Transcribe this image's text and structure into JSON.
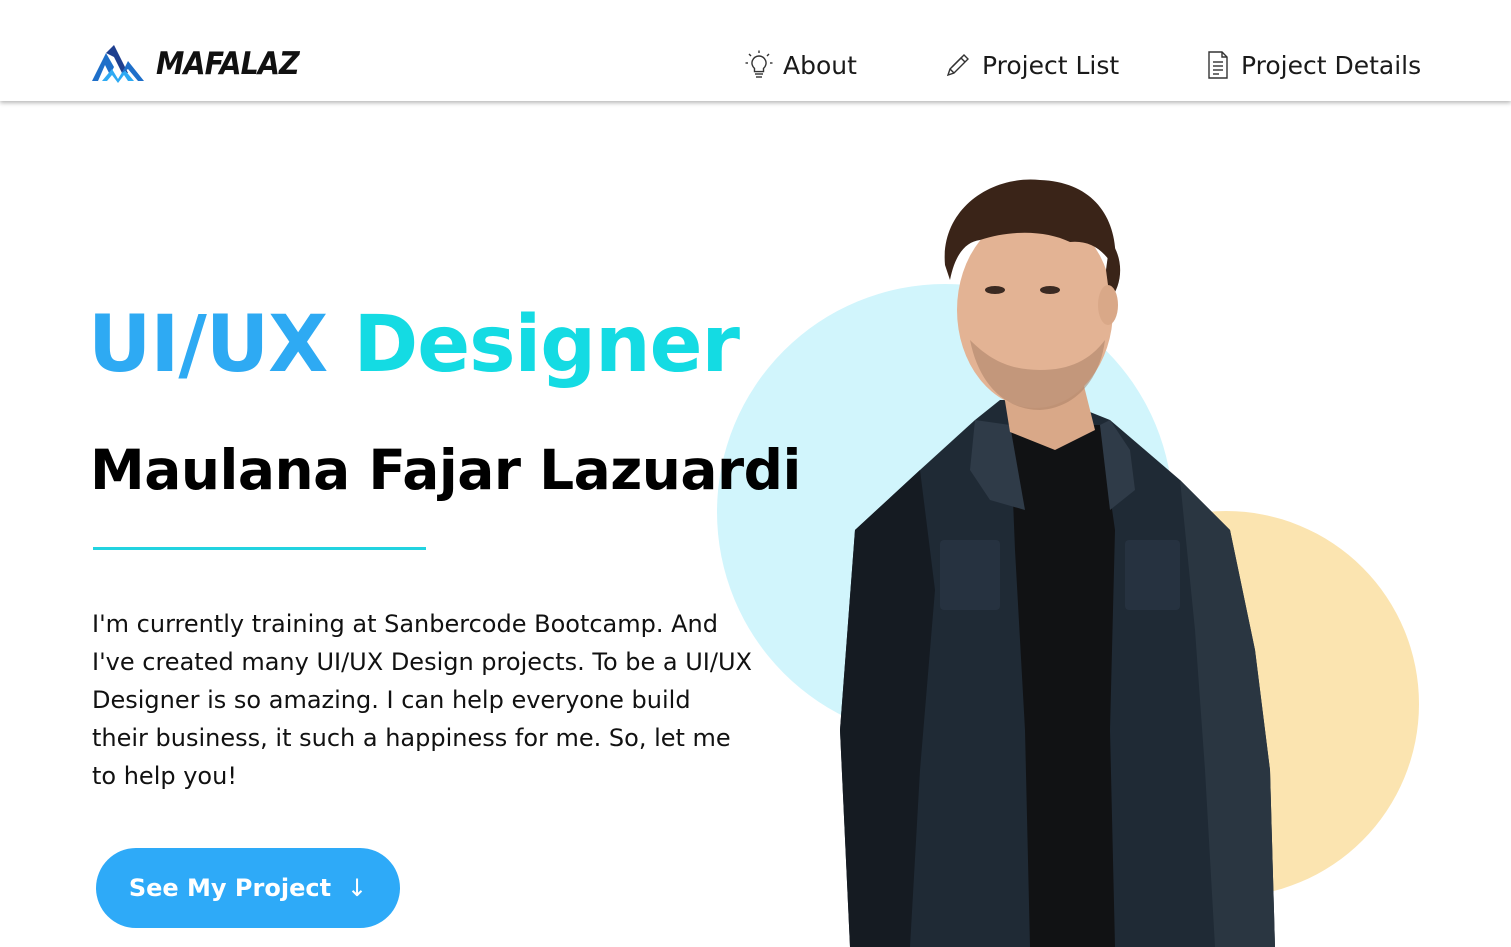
{
  "header": {
    "logo_text": "MAFALAZ",
    "nav": [
      {
        "label": "About",
        "icon": "lightbulb-icon"
      },
      {
        "label": "Project List",
        "icon": "pencil-icon"
      },
      {
        "label": "Project Details",
        "icon": "document-icon"
      }
    ]
  },
  "hero": {
    "title_part1": "UI/UX",
    "title_part2": "Designer",
    "name": "Maulana Fajar Lazuardi",
    "description": "I'm currently training at Sanbercode Bootcamp. And I've created many UI/UX Design projects. To be a UI/UX Designer is so amazing. I can help everyone build their business, it such a happiness for me. So, let me to help you!",
    "cta_label": "See My Project",
    "cta_icon": "arrow-down-icon"
  },
  "colors": {
    "accent_blue": "#2eaaf3",
    "accent_cyan": "#14dbe3",
    "circle_blue": "#d1f5fc",
    "circle_yellow": "#fbe4b0",
    "button": "#2eaaf8"
  }
}
